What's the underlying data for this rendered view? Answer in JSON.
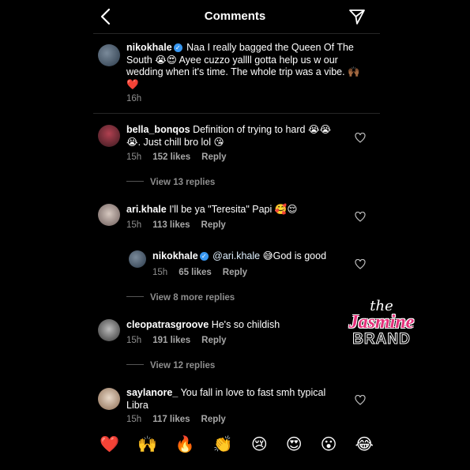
{
  "header": {
    "title": "Comments"
  },
  "caption": {
    "username": "nikokhale",
    "text": "Naa I really bagged the Queen Of The South 😭😍 Ayee cuzzo yallll gotta help us w our wedding when it's time. The whole trip was a vibe. 🙌🏾❤️",
    "time": "16h"
  },
  "comments": [
    {
      "username": "bella_bonqos",
      "text": "Definition of trying to hard 😭😭😭. Just chill bro lol 😘",
      "time": "15h",
      "likes": "152 likes",
      "reply": "Reply",
      "view_replies": "View 13 replies"
    },
    {
      "username": "ari.khale",
      "text": "I'll be ya \"Teresita\" Papi 🥰😌",
      "time": "15h",
      "likes": "113 likes",
      "reply": "Reply"
    },
    {
      "username": "nikokhale",
      "mention": "@ari.khale",
      "text": "😅God is good",
      "time": "15h",
      "likes": "65 likes",
      "reply": "Reply",
      "view_replies": "View 8 more replies",
      "is_reply": true
    },
    {
      "username": "cleopatrasgroove",
      "text": "He's so childish",
      "time": "15h",
      "likes": "191 likes",
      "reply": "Reply",
      "view_replies": "View 12 replies"
    },
    {
      "username": "saylanore_",
      "text": "You fall in love to fast smh typical Libra",
      "time": "15h",
      "likes": "117 likes",
      "reply": "Reply"
    }
  ],
  "emoji_bar": [
    "❤️",
    "🙌",
    "🔥",
    "👏",
    "😢",
    "😍",
    "😮",
    "😂"
  ],
  "watermark": {
    "the": "the",
    "jasmine": "Jasmine",
    "brand": "BRAND"
  },
  "colors": {
    "background": "#000000",
    "secondary_text": "#8e8e8e",
    "verified": "#3897f0",
    "watermark_pink": "#e5307a"
  }
}
